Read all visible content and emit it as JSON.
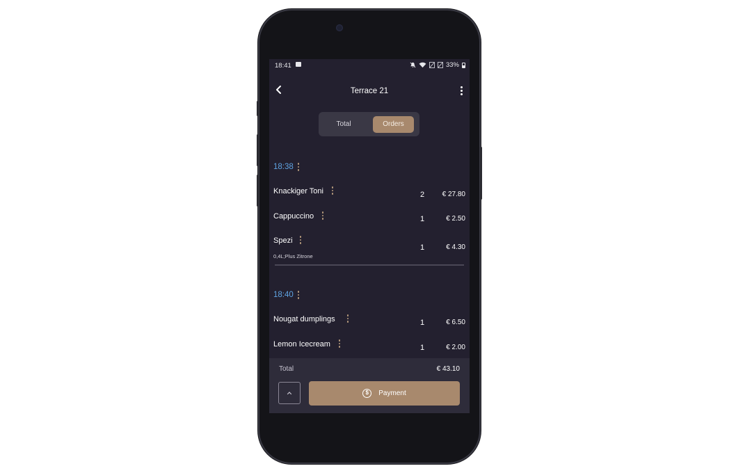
{
  "status_bar": {
    "time": "18:41",
    "battery": "33%",
    "icons": [
      "image-icon",
      "mute-icon",
      "wifi-icon",
      "signal-icon",
      "signal-icon",
      "battery-icon"
    ]
  },
  "header": {
    "title": "Terrace 21",
    "back_icon": "chevron-left-icon",
    "menu_icon": "more-vertical-icon"
  },
  "tabs": {
    "total_label": "Total",
    "orders_label": "Orders",
    "selected": "Orders"
  },
  "groups": [
    {
      "time": "18:38",
      "items": [
        {
          "name": "Knackiger Toni",
          "qty": "2",
          "price": "€ 27.80",
          "note": ""
        },
        {
          "name": "Cappuccino",
          "qty": "1",
          "price": "€ 2.50",
          "note": ""
        },
        {
          "name": "Spezi",
          "qty": "1",
          "price": "€ 4.30",
          "note": "0,4L;Plus Zitrone"
        }
      ]
    },
    {
      "time": "18:40",
      "items": [
        {
          "name": "Nougat dumplings",
          "qty": "1",
          "price": "€ 6.50",
          "note": ""
        },
        {
          "name": "Lemon Icecream",
          "qty": "1",
          "price": "€ 2.00",
          "note": ""
        }
      ]
    }
  ],
  "footer": {
    "total_label": "Total",
    "total_value": "€ 43.10",
    "payment_label": "Payment",
    "payment_icon": "dollar-coin-icon",
    "expand_icon": "chevron-up-icon"
  },
  "colors": {
    "background": "#23202f",
    "accent": "#a8896d",
    "time_blue": "#5fa3e2"
  }
}
